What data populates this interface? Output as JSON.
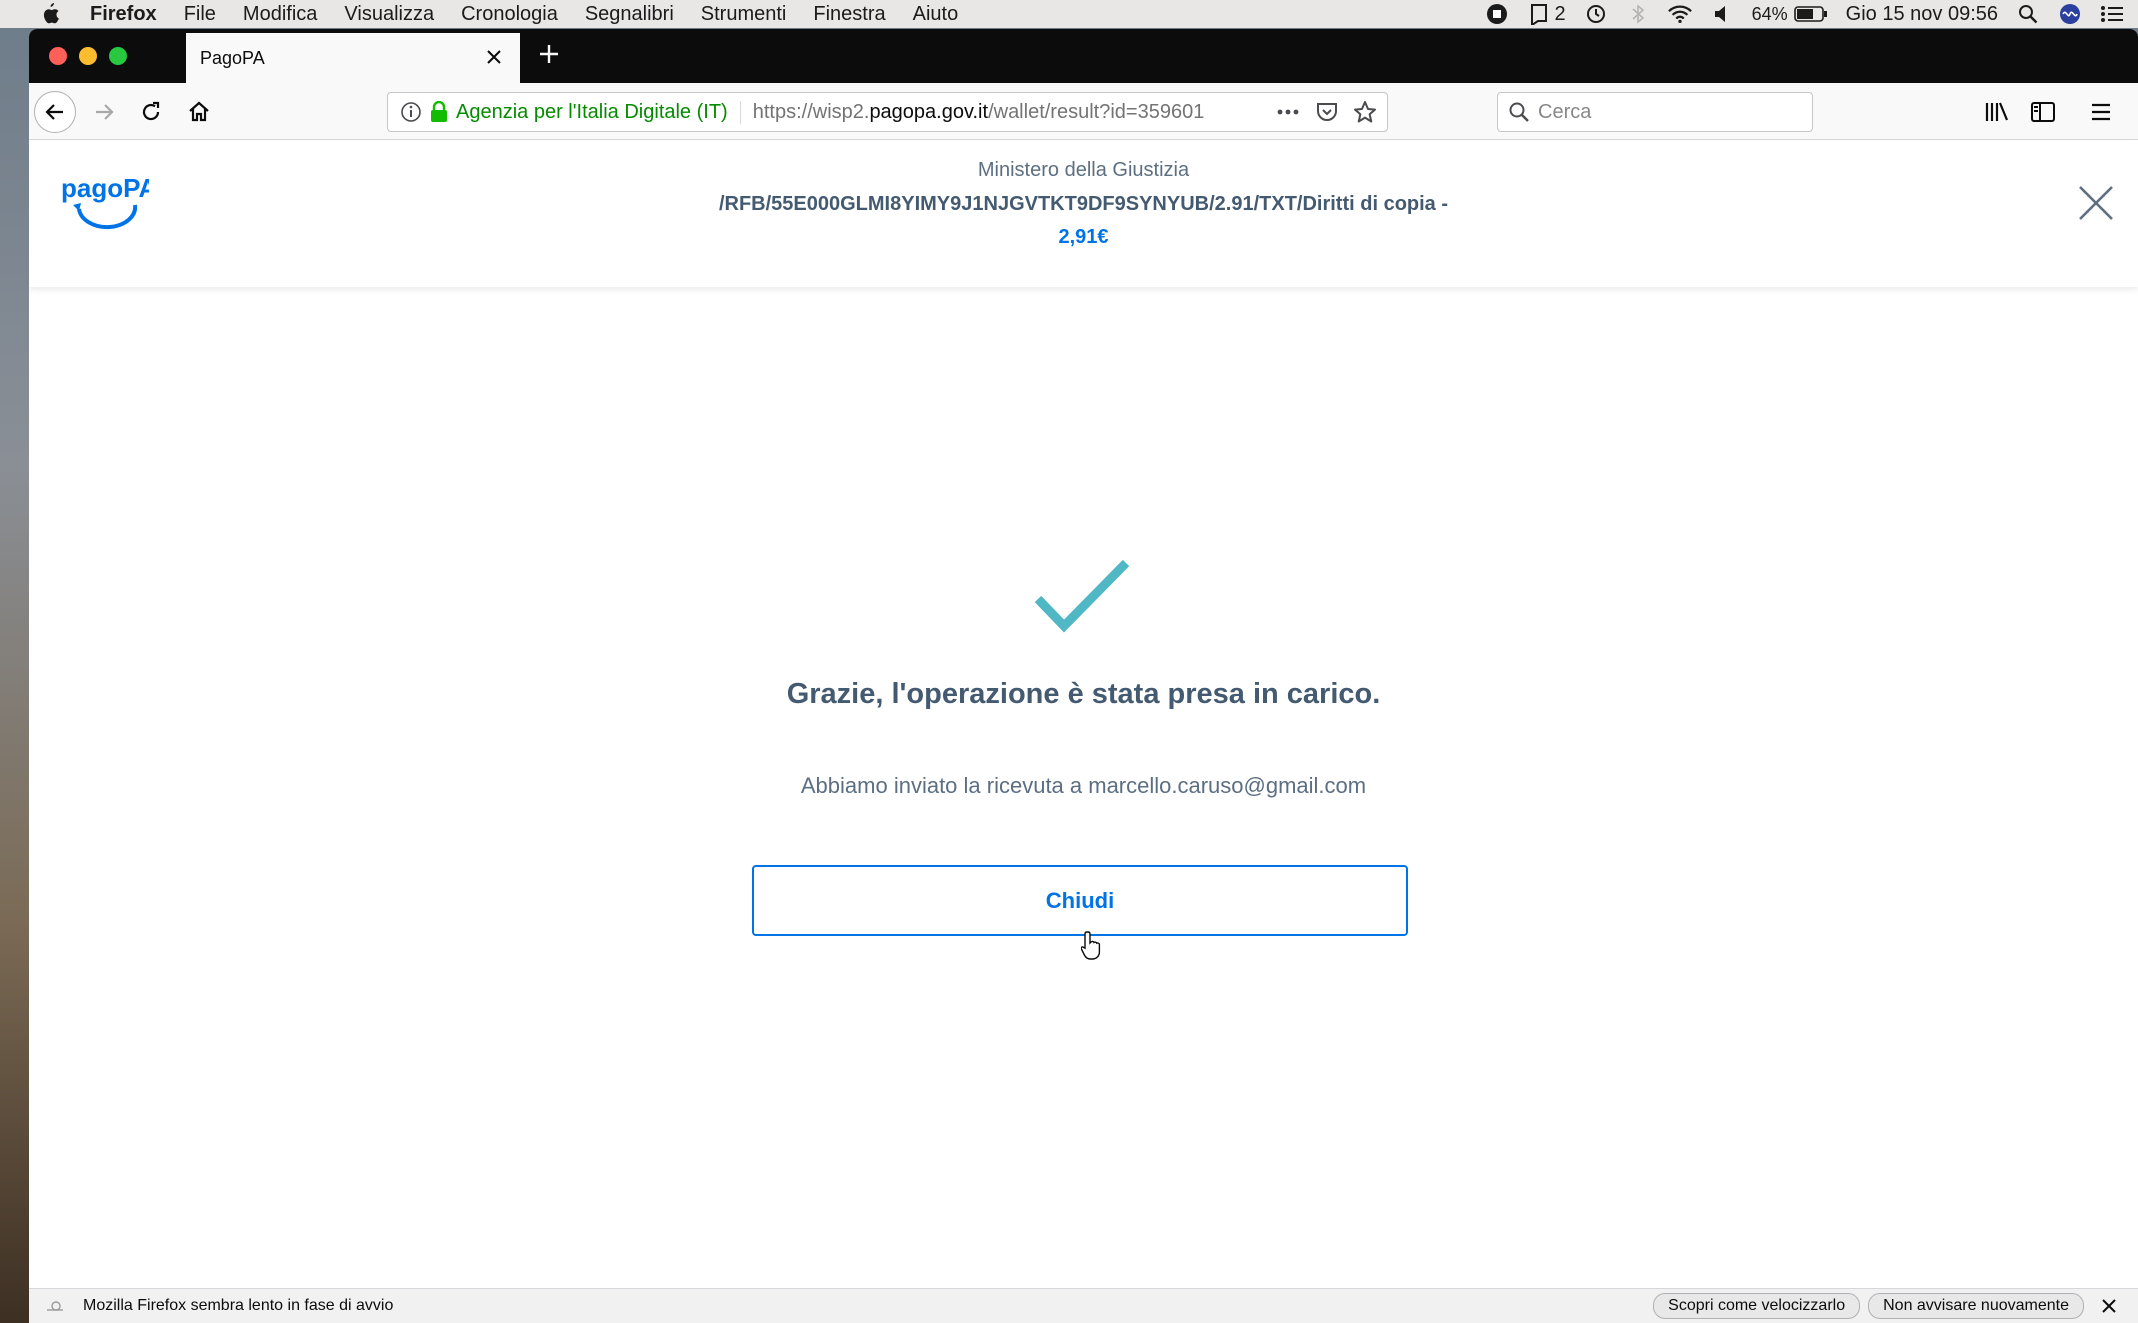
{
  "menubar": {
    "items": [
      "Firefox",
      "File",
      "Modifica",
      "Visualizza",
      "Cronologia",
      "Segnalibri",
      "Strumenti",
      "Finestra",
      "Aiuto"
    ],
    "notif_count": "2",
    "battery": "64%",
    "clock": "Gio 15 nov  09:56"
  },
  "browser": {
    "tab_title": "PagoPA",
    "identity": "Agenzia per l'Italia Digitale (IT)",
    "url_prefix": "https://wisp2.",
    "url_domain": "pagopa.gov.it",
    "url_path": "/wallet/result?id=359601",
    "search_placeholder": "Cerca"
  },
  "header": {
    "logo_text": "pagoPA",
    "merchant": "Ministero della Giustizia",
    "causale": "/RFB/55E000GLMI8YIMY9J1NJGVTKT9DF9SYNYUB/2.91/TXT/Diritti di copia -",
    "amount": "2,91€"
  },
  "result": {
    "title": "Grazie, l'operazione è stata presa in carico.",
    "receipt_msg": "Abbiamo inviato la ricevuta a marcello.caruso@gmail.com",
    "close_label": "Chiudi"
  },
  "notification": {
    "message": "Mozilla Firefox sembra lento in fase di avvio",
    "btn_speed": "Scopri come velocizzarlo",
    "btn_dismiss": "Non avvisare nuovamente"
  },
  "colors": {
    "accent": "#0073e6",
    "check": "#4fb8c4",
    "text": "#435a70"
  }
}
